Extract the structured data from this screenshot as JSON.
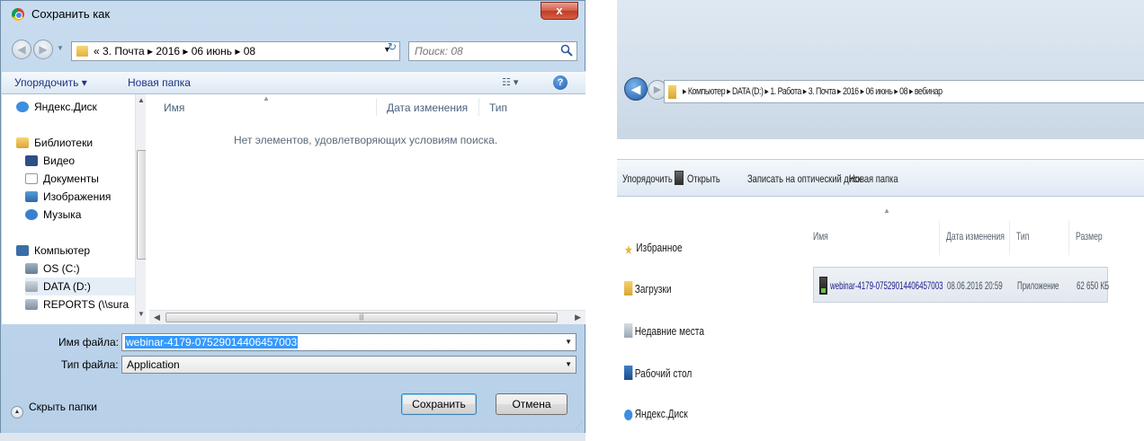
{
  "save_dialog": {
    "title": "Сохранить как",
    "close_symbol": "x",
    "address_path": "« 3. Почта ▸ 2016 ▸ 06 июнь ▸ 08",
    "search_placeholder": "Поиск: 08",
    "toolbar": {
      "organize": "Упорядочить ▾",
      "new_folder": "Новая папка",
      "view": "☷ ▾",
      "help": "?"
    },
    "nav": [
      {
        "label": "Яндекс.Диск",
        "icon": "yandex-disk-icon"
      },
      {
        "label": "Библиотеки",
        "icon": "libraries-icon"
      },
      {
        "label": "Видео",
        "icon": "video-icon"
      },
      {
        "label": "Документы",
        "icon": "documents-icon"
      },
      {
        "label": "Изображения",
        "icon": "images-icon"
      },
      {
        "label": "Музыка",
        "icon": "music-icon"
      },
      {
        "label": "Компьютер",
        "icon": "computer-icon"
      },
      {
        "label": "OS (C:)",
        "icon": "drive-icon"
      },
      {
        "label": "DATA (D:)",
        "icon": "drive-icon"
      },
      {
        "label": "REPORTS (\\\\sura",
        "icon": "network-drive-icon"
      }
    ],
    "columns": {
      "name": "Имя",
      "date": "Дата изменения",
      "type": "Тип"
    },
    "empty_message": "Нет элементов, удовлетворяющих условиям поиска.",
    "filename_label": "Имя файла:",
    "filename_value": "webinar-4179-07529014406457003",
    "filetype_label": "Тип файла:",
    "filetype_value": "Application",
    "hide_folders": "Скрыть папки",
    "save_button": "Сохранить",
    "cancel_button": "Отмена"
  },
  "explorer": {
    "address_path": "▸ Компьютер ▸ DATA (D:) ▸ 1. Работа ▸ 3. Почта ▸ 2016 ▸ 06 июнь ▸ 08 ▸ вебинар",
    "toolbar": {
      "organize": "Упорядочить ▾",
      "open": "Открыть",
      "burn": "Записать на оптический диск",
      "new_folder": "Новая папка"
    },
    "nav": [
      {
        "label": "Избранное",
        "icon": "favorites-star-icon"
      },
      {
        "label": "Загрузки",
        "icon": "downloads-icon"
      },
      {
        "label": "Недавние места",
        "icon": "recent-places-icon"
      },
      {
        "label": "Рабочий стол",
        "icon": "desktop-icon"
      },
      {
        "label": "Яндекс.Диск",
        "icon": "yandex-disk-icon"
      }
    ],
    "columns": {
      "name": "Имя",
      "date": "Дата изменения",
      "type": "Тип",
      "size": "Размер"
    },
    "file": {
      "name": "webinar-4179-07529014406457003",
      "date": "08.06.2016 20:59",
      "type": "Приложение",
      "size": "62 650 КБ"
    }
  },
  "colors": {
    "accent_blue": "#3399ff",
    "title_bar": "#b7d0e8",
    "close_red": "#c13b26"
  }
}
